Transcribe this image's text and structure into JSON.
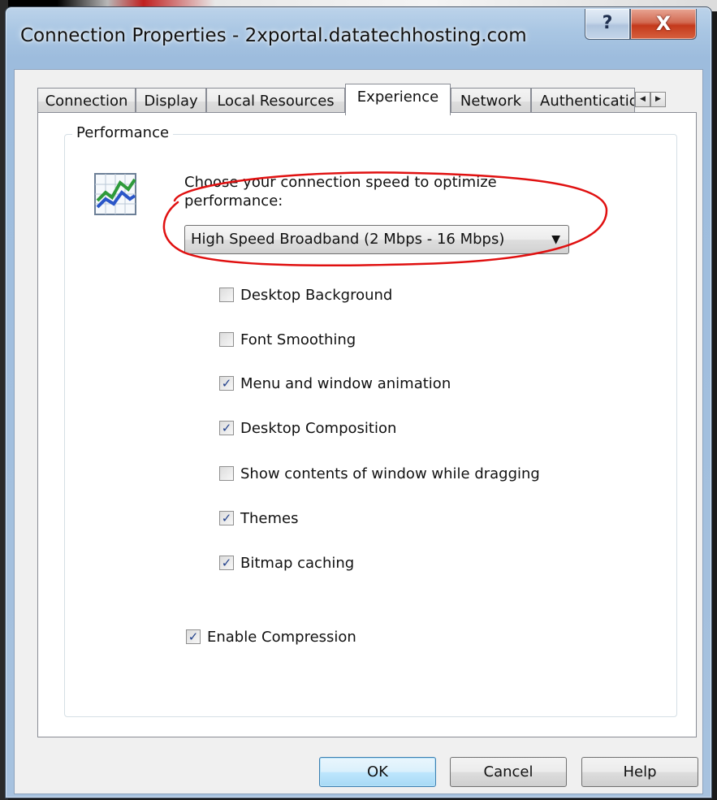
{
  "window": {
    "title": "Connection Properties - 2xportal.datatechhosting.com",
    "help_glyph": "?",
    "close_glyph": "X"
  },
  "tabs": [
    {
      "label": "Connection",
      "active": false
    },
    {
      "label": "Display",
      "active": false
    },
    {
      "label": "Local Resources",
      "active": false
    },
    {
      "label": "Experience",
      "active": true
    },
    {
      "label": "Network",
      "active": false
    },
    {
      "label": "Authentication",
      "active": false
    }
  ],
  "tab_scroll": {
    "left": "◀",
    "right": "▶"
  },
  "performance": {
    "group_label": "Performance",
    "prompt": "Choose your connection speed to optimize performance:",
    "speed_selected": "High Speed Broadband (2 Mbps - 16 Mbps)",
    "dropdown_arrow": "▼",
    "options": [
      {
        "label": "Desktop Background",
        "checked": false
      },
      {
        "label": "Font Smoothing",
        "checked": false
      },
      {
        "label": "Menu and window animation",
        "checked": true
      },
      {
        "label": "Desktop Composition",
        "checked": true
      },
      {
        "label": "Show contents of window while dragging",
        "checked": false
      },
      {
        "label": "Themes",
        "checked": true
      },
      {
        "label": "Bitmap caching",
        "checked": true
      }
    ],
    "compression": {
      "label": "Enable Compression",
      "checked": true
    }
  },
  "buttons": {
    "ok": "OK",
    "cancel": "Cancel",
    "help": "Help"
  },
  "colors": {
    "annotation": "#e01010",
    "check": "#21408b",
    "close_button": "#c4391b"
  }
}
